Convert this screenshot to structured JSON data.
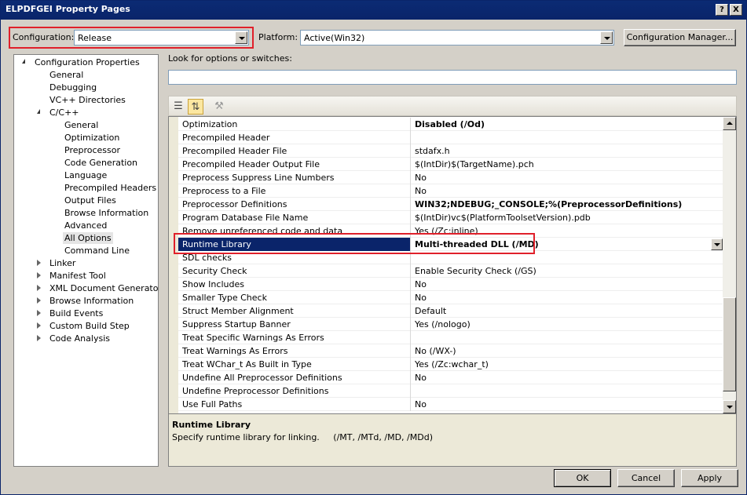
{
  "window": {
    "title": "ELPDFGEI Property Pages",
    "help_button": "?",
    "close_button": "X"
  },
  "config": {
    "configuration_label": "Configuration:",
    "configuration_value": "Release",
    "platform_label": "Platform:",
    "platform_value": "Active(Win32)",
    "manager_button": "Configuration Manager..."
  },
  "tree": [
    {
      "label": "Configuration Properties",
      "level": 0,
      "expander": "open"
    },
    {
      "label": "General",
      "level": 1
    },
    {
      "label": "Debugging",
      "level": 1
    },
    {
      "label": "VC++ Directories",
      "level": 1
    },
    {
      "label": "C/C++",
      "level": 1,
      "expander": "open"
    },
    {
      "label": "General",
      "level": 2
    },
    {
      "label": "Optimization",
      "level": 2
    },
    {
      "label": "Preprocessor",
      "level": 2
    },
    {
      "label": "Code Generation",
      "level": 2
    },
    {
      "label": "Language",
      "level": 2
    },
    {
      "label": "Precompiled Headers",
      "level": 2
    },
    {
      "label": "Output Files",
      "level": 2
    },
    {
      "label": "Browse Information",
      "level": 2
    },
    {
      "label": "Advanced",
      "level": 2
    },
    {
      "label": "All Options",
      "level": 2,
      "selected": true
    },
    {
      "label": "Command Line",
      "level": 2
    },
    {
      "label": "Linker",
      "level": 1,
      "expander": "closed"
    },
    {
      "label": "Manifest Tool",
      "level": 1,
      "expander": "closed"
    },
    {
      "label": "XML Document Generator",
      "level": 1,
      "expander": "closed"
    },
    {
      "label": "Browse Information",
      "level": 1,
      "expander": "closed"
    },
    {
      "label": "Build Events",
      "level": 1,
      "expander": "closed"
    },
    {
      "label": "Custom Build Step",
      "level": 1,
      "expander": "closed"
    },
    {
      "label": "Code Analysis",
      "level": 1,
      "expander": "closed"
    }
  ],
  "search": {
    "label": "Look for options or switches:",
    "value": ""
  },
  "toolbar_icons": [
    "categorized-icon",
    "alphabetical-sort-icon",
    "property-pages-icon"
  ],
  "properties": [
    {
      "name": "Optimization",
      "value": "Disabled (/Od)",
      "bold": true
    },
    {
      "name": "Precompiled Header",
      "value": ""
    },
    {
      "name": "Precompiled Header File",
      "value": "stdafx.h"
    },
    {
      "name": "Precompiled Header Output File",
      "value": "$(IntDir)$(TargetName).pch"
    },
    {
      "name": "Preprocess Suppress Line Numbers",
      "value": "No"
    },
    {
      "name": "Preprocess to a File",
      "value": "No"
    },
    {
      "name": "Preprocessor Definitions",
      "value": "WIN32;NDEBUG;_CONSOLE;%(PreprocessorDefinitions)",
      "bold": true
    },
    {
      "name": "Program Database File Name",
      "value": "$(IntDir)vc$(PlatformToolsetVersion).pdb"
    },
    {
      "name": "Remove unreferenced code and data",
      "value": "Yes (/Zc:inline)"
    },
    {
      "name": "Runtime Library",
      "value": "Multi-threaded DLL (/MD)",
      "selected": true
    },
    {
      "name": "SDL checks",
      "value": ""
    },
    {
      "name": "Security Check",
      "value": "Enable Security Check (/GS)"
    },
    {
      "name": "Show Includes",
      "value": "No"
    },
    {
      "name": "Smaller Type Check",
      "value": "No"
    },
    {
      "name": "Struct Member Alignment",
      "value": "Default"
    },
    {
      "name": "Suppress Startup Banner",
      "value": "Yes (/nologo)"
    },
    {
      "name": "Treat Specific Warnings As Errors",
      "value": ""
    },
    {
      "name": "Treat Warnings As Errors",
      "value": "No (/WX-)"
    },
    {
      "name": "Treat WChar_t As Built in Type",
      "value": "Yes (/Zc:wchar_t)"
    },
    {
      "name": "Undefine All Preprocessor Definitions",
      "value": "No"
    },
    {
      "name": "Undefine Preprocessor Definitions",
      "value": ""
    },
    {
      "name": "Use Full Paths",
      "value": "No"
    }
  ],
  "description": {
    "title": "Runtime Library",
    "body": "Specify runtime library for linking.     (/MT, /MTd, /MD, /MDd)"
  },
  "buttons": {
    "ok": "OK",
    "cancel": "Cancel",
    "apply": "Apply"
  },
  "colors": {
    "highlight": "#0a246a",
    "annotation_red": "#e0202a"
  }
}
